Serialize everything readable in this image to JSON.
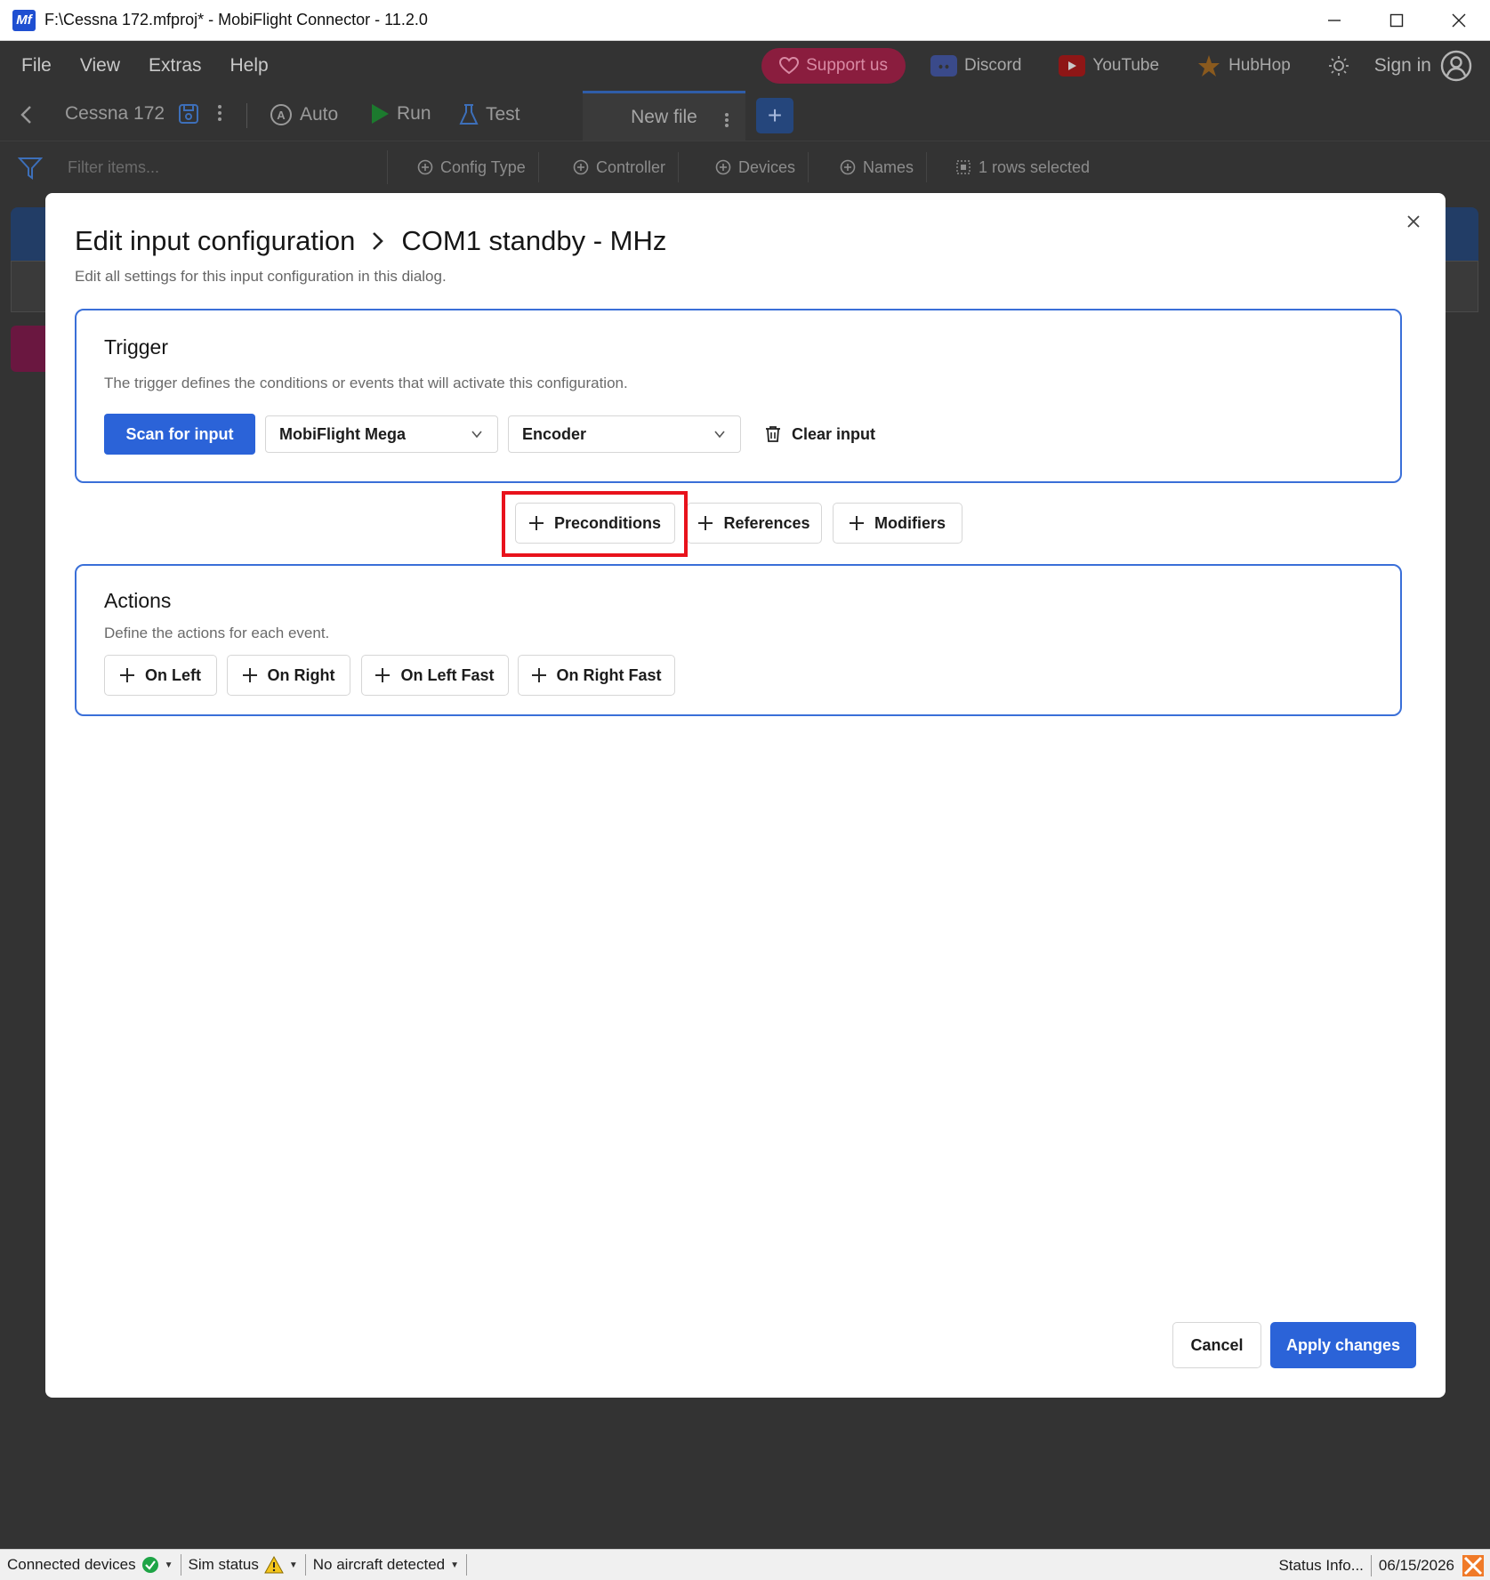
{
  "window": {
    "logo_text": "Mf",
    "title": "F:\\Cessna 172.mfproj* - MobiFlight Connector - 11.2.0"
  },
  "menu": {
    "items": [
      "File",
      "View",
      "Extras",
      "Help"
    ],
    "support_label": "Support us",
    "discord_label": "Discord",
    "youtube_label": "YouTube",
    "hubhop_label": "HubHop",
    "sign_in_label": "Sign in"
  },
  "toolbar": {
    "project_name": "Cessna 172",
    "auto_label": "Auto",
    "run_label": "Run",
    "test_label": "Test",
    "file_tab_label": "New file",
    "add_tab_label": "+"
  },
  "filterbar": {
    "filter_placeholder": "Filter items...",
    "chips": [
      "Config Type",
      "Controller",
      "Devices",
      "Names"
    ],
    "selection_label": "1 rows selected"
  },
  "dialog": {
    "title": "Edit input configuration",
    "title_item": "COM1 standby - MHz",
    "subtitle": "Edit all settings for this input configuration in this dialog.",
    "trigger": {
      "title": "Trigger",
      "description": "The trigger defines the conditions or events that will activate this configuration.",
      "scan_label": "Scan for input",
      "controller_value": "MobiFlight Mega",
      "device_value": "Encoder",
      "clear_label": "Clear input"
    },
    "extras": {
      "preconditions_label": "Preconditions",
      "references_label": "References",
      "modifiers_label": "Modifiers"
    },
    "actions": {
      "title": "Actions",
      "description": "Define the actions for each event.",
      "on_left_label": "On Left",
      "on_right_label": "On Right",
      "on_left_fast_label": "On Left Fast",
      "on_right_fast_label": "On Right Fast"
    },
    "cancel_label": "Cancel",
    "apply_label": "Apply changes"
  },
  "statusbar": {
    "connected_devices": "Connected devices",
    "sim_status": "Sim status",
    "aircraft": "No aircraft detected",
    "status_info": "Status Info...",
    "date": "06/15/2026"
  },
  "colors": {
    "accent": "#2b63d8",
    "highlight": "#e8121c",
    "dim_background": "#333333"
  }
}
